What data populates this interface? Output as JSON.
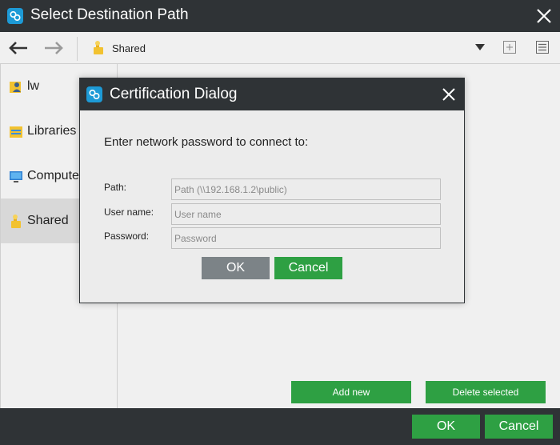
{
  "window": {
    "title": "Select Destination Path",
    "icon": "app-logo-icon"
  },
  "toolbar": {
    "location_label": "Shared",
    "icons": [
      "back-arrow-icon",
      "forward-arrow-icon",
      "shared-folder-icon",
      "dropdown-arrow-icon",
      "new-folder-icon",
      "view-list-icon"
    ]
  },
  "sidebar": {
    "items": [
      {
        "label": "lw",
        "icon": "user-folder-icon",
        "selected": false
      },
      {
        "label": "Libraries",
        "icon": "libraries-icon",
        "selected": false
      },
      {
        "label": "Computer",
        "icon": "computer-icon",
        "selected": false
      },
      {
        "label": "Shared",
        "icon": "shared-icon",
        "selected": true
      }
    ]
  },
  "main": {
    "add_new_label": "Add new",
    "delete_selected_label": "Delete selected"
  },
  "footer": {
    "ok_label": "OK",
    "cancel_label": "Cancel"
  },
  "dialog": {
    "title": "Certification Dialog",
    "prompt": "Enter network password to connect to:",
    "path_label": "Path:",
    "path_placeholder": "Path (\\\\192.168.1.2\\public)",
    "username_label": "User name:",
    "username_placeholder": "User name",
    "password_label": "Password:",
    "password_placeholder": "Password",
    "ok_label": "OK",
    "cancel_label": "Cancel"
  },
  "colors": {
    "dark_chrome": "#2f3336",
    "accent_green": "#2ea043",
    "disabled_gray": "#7c8387",
    "panel_bg": "#f0f0f0",
    "icon_blue": "#1d9ad6"
  }
}
